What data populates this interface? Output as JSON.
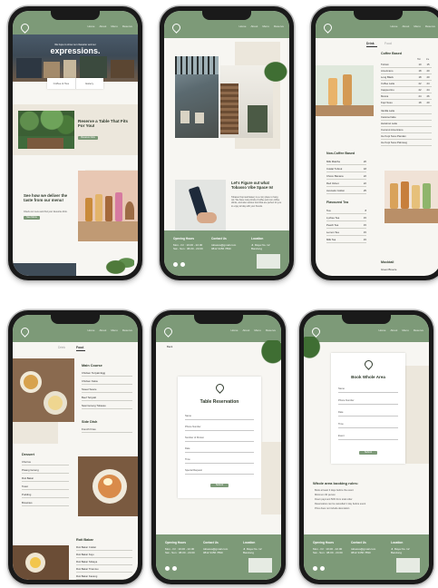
{
  "nav": [
    "Home",
    "About",
    "Menu",
    "Reserve",
    "Book Whole Area"
  ],
  "p1": {
    "hero_small": "We hope to show our character and our",
    "hero_big": "expressions.",
    "badge_a": "Coffee & Tea",
    "badge_b": "Eatery",
    "reserve_title": "Reserve a Table That Fits For You!",
    "reserve_btn": "Reserve Now",
    "deliver_title": "See how we deliver the taste from our menu!",
    "deliver_text": "Check our menu and find your favourite drink.",
    "deliver_btn": "See Menu"
  },
  "p2": {
    "about_title": "Let's Figure out what Tobasso Vibe Space Is!",
    "about_text": "Tobasso Kopi and Eatery is a cozy place to hang out. We have many kinds of coffee and non-coffee drinks, and also various food that are perfect for you to enjoy all day with your friends."
  },
  "p3": {
    "tab_drink": "Drink",
    "tab_food": "Food",
    "coffee_title": "Coffee Based",
    "col_hot": "Hot",
    "col_ice": "Ice",
    "coffee_items": [
      {
        "name": "Tubruk",
        "hot": "10",
        "ice": "15"
      },
      {
        "name": "Americano",
        "hot": "18",
        "ice": "20"
      },
      {
        "name": "Long Black",
        "hot": "18",
        "ice": "20"
      },
      {
        "name": "Coffee Latte",
        "hot": "22",
        "ice": "24"
      },
      {
        "name": "Cappuccino",
        "hot": "22",
        "ice": "24"
      },
      {
        "name": "Mocca",
        "hot": "24",
        "ice": "26"
      },
      {
        "name": "Kopi Susu",
        "hot": "18",
        "ice": "20"
      }
    ],
    "coffee_more": [
      "Vanilla Latte",
      "Caramel latte",
      "Hazelnut Latte",
      "Coconut Americano",
      "Ice Kopi Susu Pandan",
      "Ice Kopi Susu Palmsug"
    ],
    "noncoffee_title": "Non-Coffee Based",
    "noncoffee_items": [
      {
        "name": "Milk Matcha",
        "p": "20"
      },
      {
        "name": "Coklat Tubruk",
        "p": "18"
      },
      {
        "name": "Choco Banana",
        "p": "22"
      },
      {
        "name": "Red Velvet",
        "p": "22"
      },
      {
        "name": "Avocado Coklat",
        "p": "25"
      }
    ],
    "flavoured_title": "Flavoured Tea",
    "flavoured_items": [
      {
        "name": "Tea",
        "p": "8"
      },
      {
        "name": "Lychee Tea",
        "p": "15"
      },
      {
        "name": "Peach Tea",
        "p": "15"
      },
      {
        "name": "Lemon Tea",
        "p": "15"
      },
      {
        "name": "Milk Tea",
        "p": "15"
      }
    ],
    "mocktail_title": "Mocktail",
    "mocktail_item": "Green Breeze"
  },
  "p4": {
    "tab_drink": "Drink",
    "tab_food": "Food",
    "main_title": "Main Course",
    "main_items": [
      "Chicken Teriyaki Egg",
      "Chicken Katsu",
      "Sweet Sauce",
      "Beef Teriyaki",
      "Nasi Goreng Tobasso"
    ],
    "side_title": "Side Dish",
    "side_items": [
      "French Fries"
    ],
    "dessert_title": "Dessert",
    "dessert_items": [
      "Churros",
      "Pisang Goreng",
      "Roti Bakar",
      "Toast",
      "Pudding",
      "Brownies"
    ],
    "roti_title": "Roti Bakar",
    "roti_items": [
      "Roti Bakar Coklat",
      "Roti Bakar Keju",
      "Roti Bakar Srikaya",
      "Roti Bakar Tiramisu",
      "Roti Bakar Kacang"
    ]
  },
  "p5": {
    "back": "Back",
    "title": "Table Reservation",
    "fields": [
      "Name",
      "Phone Number",
      "Number of Person",
      "Date",
      "Time",
      "Special Request"
    ],
    "btn": "Submit"
  },
  "p6": {
    "title": "Book Whole Area",
    "fields": [
      "Name",
      "Phone Number",
      "Date",
      "Time",
      "Event"
    ],
    "btn": "Submit",
    "rules_title": "Whole area booking rules:",
    "rules": [
      "Book at least 3 days before the event",
      "Minimum 30 person",
      "Down payment 50% from total order",
      "Reservation can be cancelled 1 day before event",
      "Price does not include decoration"
    ]
  },
  "footer": {
    "col1_title": "Opening Hours",
    "col1": [
      "Mon - Fri : 10.00 - 22.00",
      "Sat - Sun : 08.00 - 23.00"
    ],
    "col2_title": "Contact Us",
    "col2": [
      "tobasso@gmail.com",
      "0812 3456 7890"
    ],
    "col3_title": "Location",
    "col3": [
      "Jl. Raya No. 12",
      "Bandung"
    ]
  },
  "colors": {
    "brand_green": "#7d9a78",
    "beige": "#ece7dc",
    "dark": "#2f3a2c"
  }
}
